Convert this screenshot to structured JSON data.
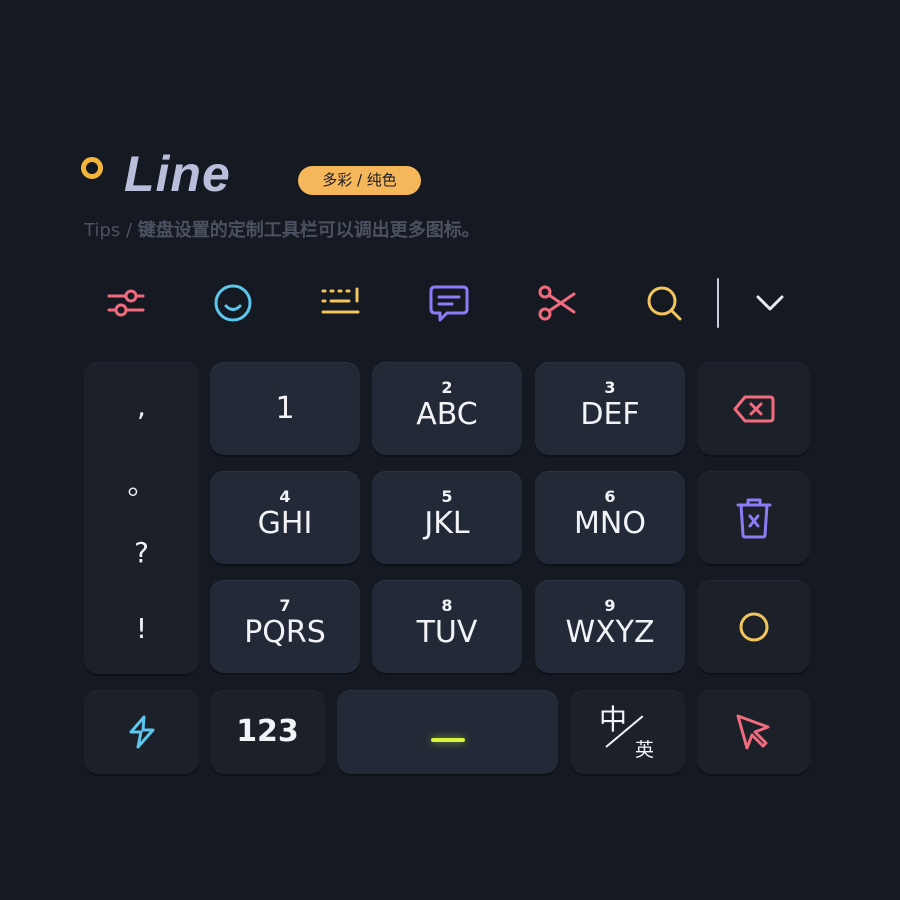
{
  "header": {
    "title": "Line",
    "badge": "多彩 / 纯色",
    "tips_prefix": "Tips / ",
    "tips_text": "键盘设置的定制工具栏可以调出更多图标。"
  },
  "toolbar": {
    "icons": [
      "sliders-icon",
      "smiley-icon",
      "keyboard-icon",
      "message-icon",
      "scissors-icon",
      "search-icon"
    ],
    "expand_icon": "chevron-down-icon"
  },
  "punctuation": [
    ",",
    "。",
    "?",
    "!"
  ],
  "keypad": [
    {
      "num": "",
      "letters": "1"
    },
    {
      "num": "2",
      "letters": "ABC"
    },
    {
      "num": "3",
      "letters": "DEF"
    },
    {
      "num": "4",
      "letters": "GHI"
    },
    {
      "num": "5",
      "letters": "JKL"
    },
    {
      "num": "6",
      "letters": "MNO"
    },
    {
      "num": "7",
      "letters": "PQRS"
    },
    {
      "num": "8",
      "letters": "TUV"
    },
    {
      "num": "9",
      "letters": "WXYZ"
    }
  ],
  "side_keys": {
    "backspace_icon": "backspace-icon",
    "clear_icon": "trash-icon",
    "zero_icon": "circle-icon"
  },
  "bottom_row": {
    "symbols_icon": "bolt-icon",
    "numbers_label": "123",
    "lang_zh": "中",
    "lang_en": "英",
    "cursor_icon": "cursor-icon"
  },
  "colors": {
    "background": "#151922",
    "title": "#B9BEDB",
    "accent_yellow": "#F4B63A",
    "badge": "#F6B65A",
    "red": "#F06B7E",
    "blue": "#5CC6EC",
    "purple": "#8E7CF6",
    "yellow": "#F2C45C",
    "space_line": "#D7F53C"
  }
}
